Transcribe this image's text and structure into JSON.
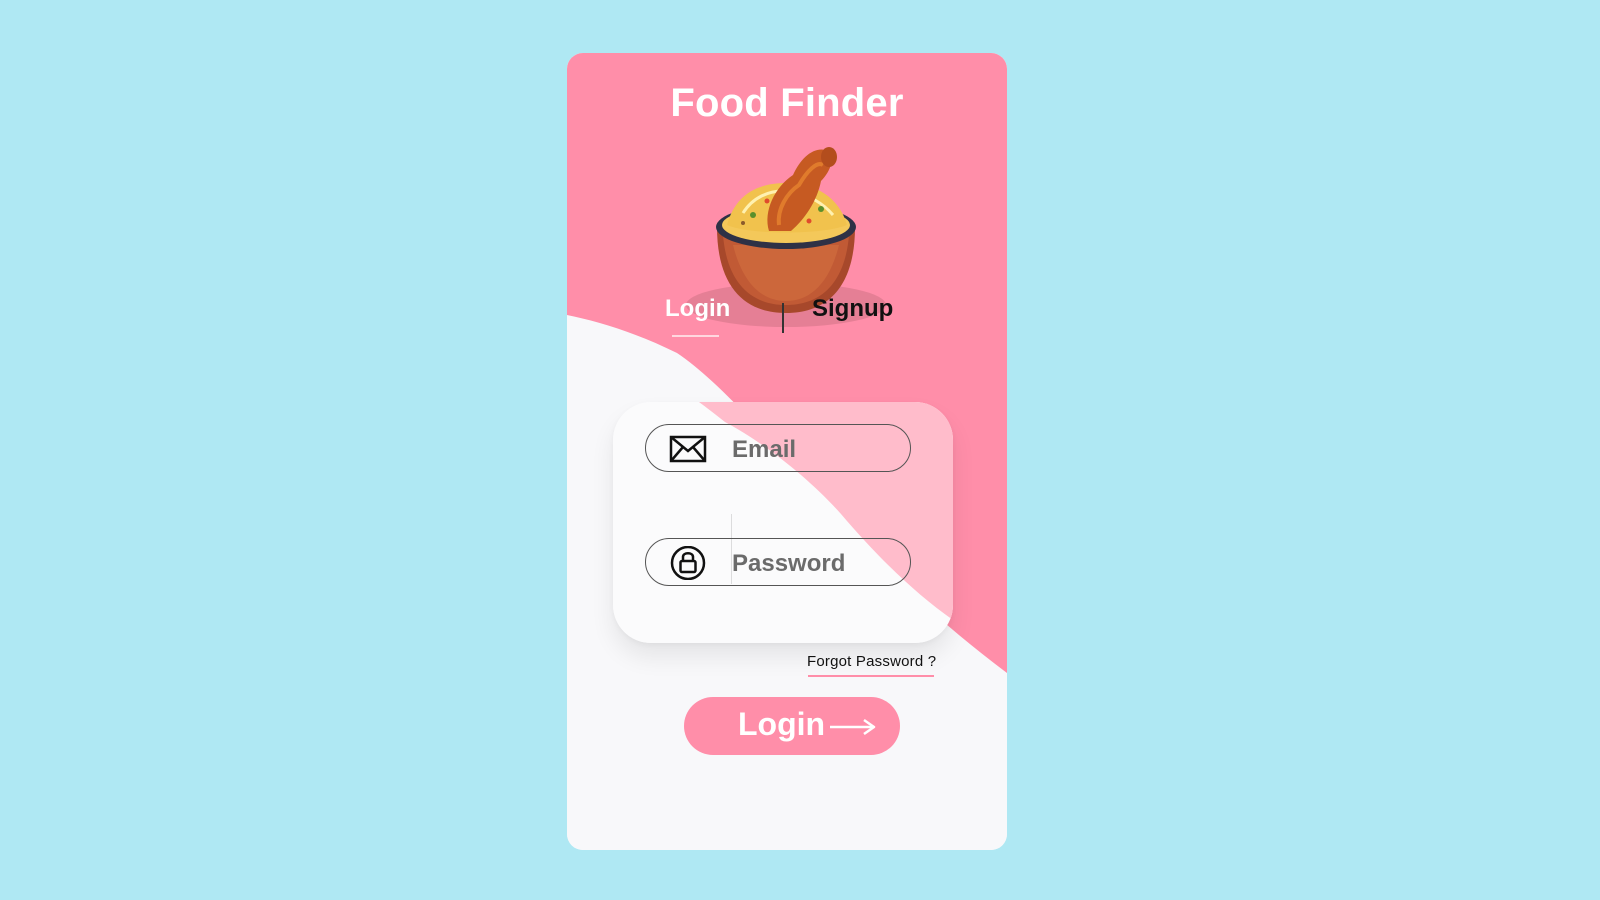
{
  "app": {
    "title": "Food Finder"
  },
  "tabs": {
    "login_label": "Login",
    "signup_label": "Signup",
    "active": "login"
  },
  "form": {
    "email_placeholder": "Email",
    "password_placeholder": "Password",
    "email_icon": "envelope-icon",
    "password_icon": "lock-icon"
  },
  "links": {
    "forgot_password": "Forgot Password ?"
  },
  "submit": {
    "label": "Login",
    "icon": "arrow-right-icon"
  },
  "colors": {
    "page_background": "#afe8f3",
    "card_pink": "#ff8ea9",
    "card_white": "#f8f8fa",
    "accent": "#ff8ea9"
  }
}
